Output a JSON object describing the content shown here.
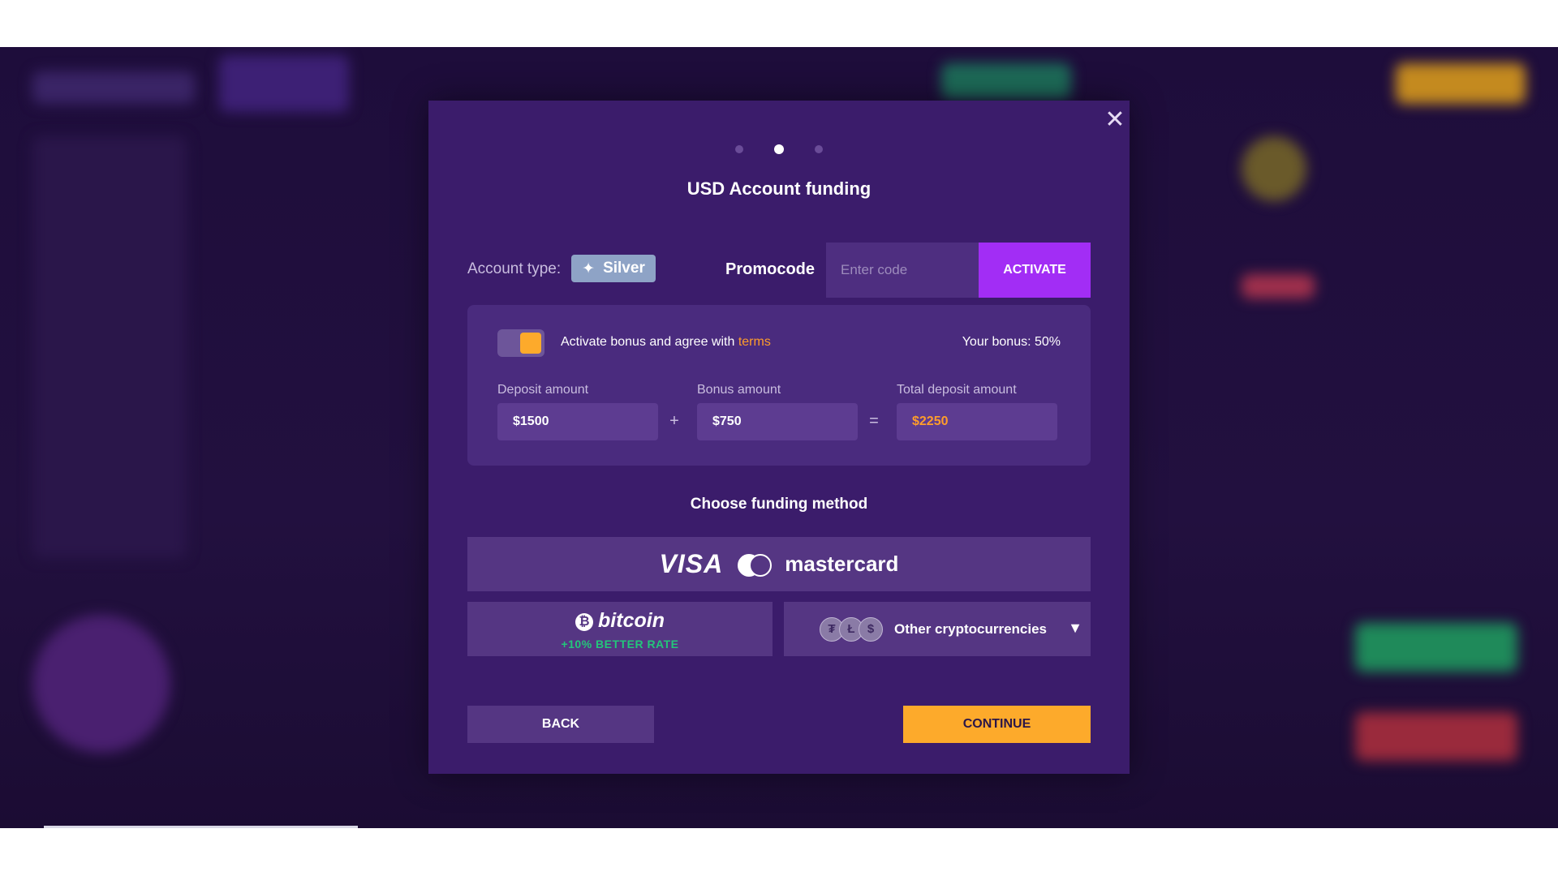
{
  "modal": {
    "close_icon": "close-icon",
    "steps": {
      "total": 3,
      "active": 2
    },
    "title": "USD Account funding"
  },
  "account": {
    "label": "Account type:",
    "type": "Silver",
    "type_icon": "sparkle-icon",
    "badge_color": "#8ea3c6"
  },
  "promo": {
    "label": "Promocode",
    "placeholder": "Enter code",
    "value": "",
    "activate_label": "ACTIVATE"
  },
  "bonus": {
    "toggle_on": true,
    "activate_text": "Activate bonus and agree with",
    "terms_label": "terms",
    "your_bonus": "Your bonus: 50%",
    "deposit_label": "Deposit amount",
    "deposit_value": "$1500",
    "plus": "+",
    "bonus_label": "Bonus amount",
    "bonus_value": "$750",
    "equals": "=",
    "total_label": "Total deposit amount",
    "total_value": "$2250"
  },
  "funding": {
    "title": "Choose funding method",
    "card": {
      "visa": "VISA",
      "mastercard": "mastercard"
    },
    "bitcoin": {
      "name": "bitcoin",
      "symbol": "₿",
      "rate": "+10% BETTER RATE"
    },
    "crypto": {
      "label": "Other cryptocurrencies",
      "coins": [
        "₮",
        "Ł",
        "$"
      ]
    }
  },
  "actions": {
    "back": "BACK",
    "continue": "CONTINUE"
  },
  "colors": {
    "accent_purple": "#a22df5",
    "accent_orange": "#fdaa2b",
    "modal_bg": "#3b1c6b",
    "green": "#23c67a"
  }
}
